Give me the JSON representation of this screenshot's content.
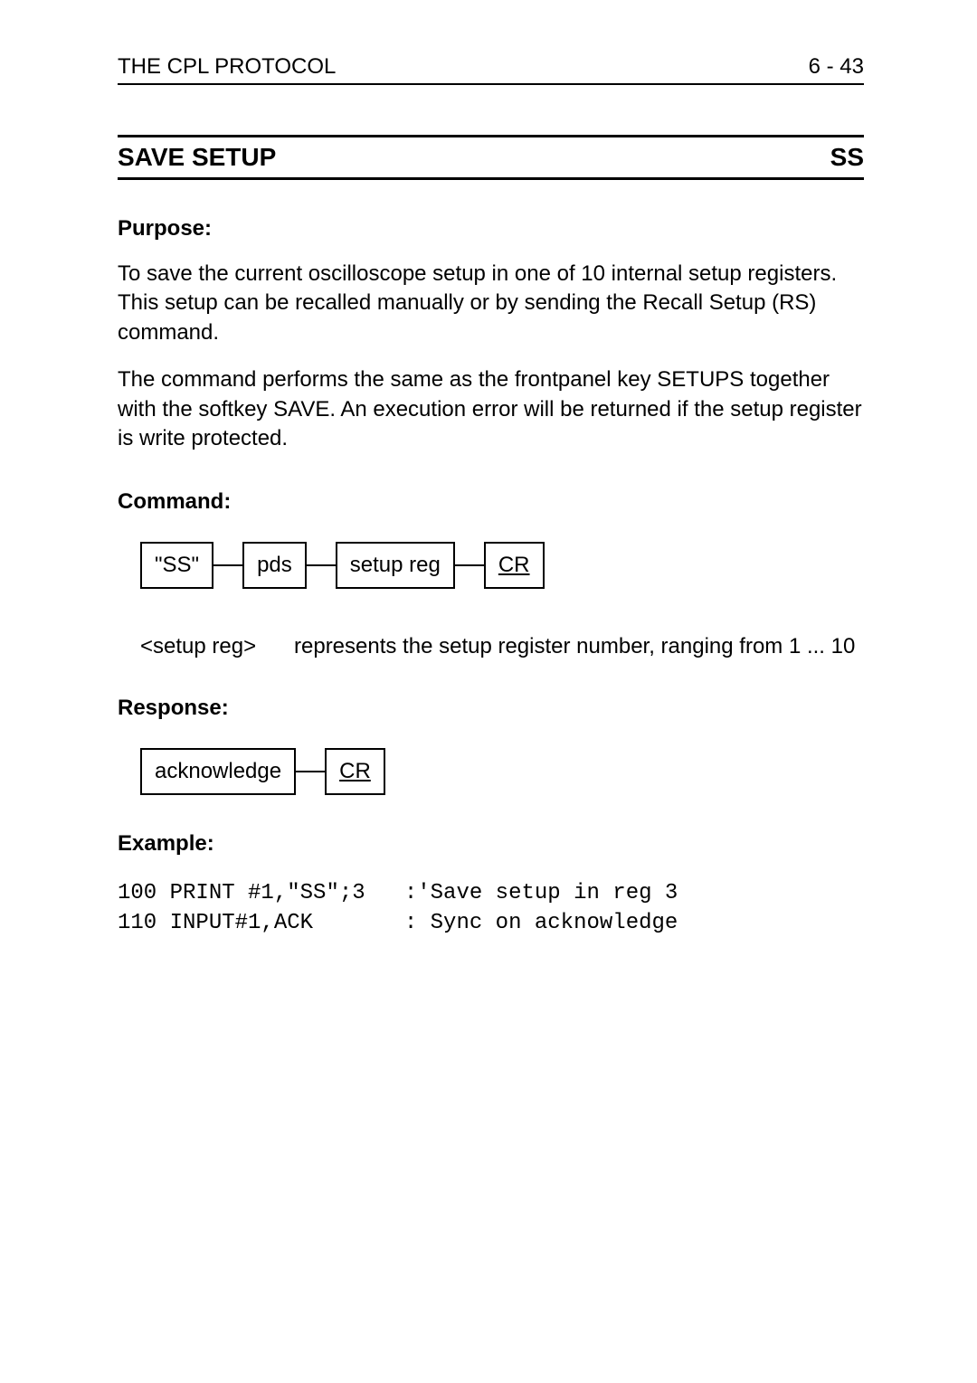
{
  "header": {
    "left": "THE CPL PROTOCOL",
    "right": "6 - 43"
  },
  "title": {
    "left": "SAVE SETUP",
    "right": "SS"
  },
  "purpose": {
    "heading": "Purpose:",
    "p1": "To save the current oscilloscope setup in one of 10 internal setup registers. This setup can be recalled manually or by sending the Recall Setup (RS) command.",
    "p2": "The command performs the same as the frontpanel key SETUPS together with the softkey SAVE. An execution error will be returned if the setup register is write protected."
  },
  "command": {
    "heading": "Command:",
    "box1": "\"SS\"",
    "box2": "pds",
    "box3": "setup reg",
    "box4": "CR",
    "param_label": "<setup reg>",
    "param_desc": "represents the setup register number, ranging from 1 ... 10"
  },
  "response": {
    "heading": "Response:",
    "box1": "acknowledge",
    "box2": "CR"
  },
  "example": {
    "heading": "Example:",
    "code": "100 PRINT #1,\"SS\";3   :'Save setup in reg 3\n110 INPUT#1,ACK       : Sync on acknowledge"
  }
}
